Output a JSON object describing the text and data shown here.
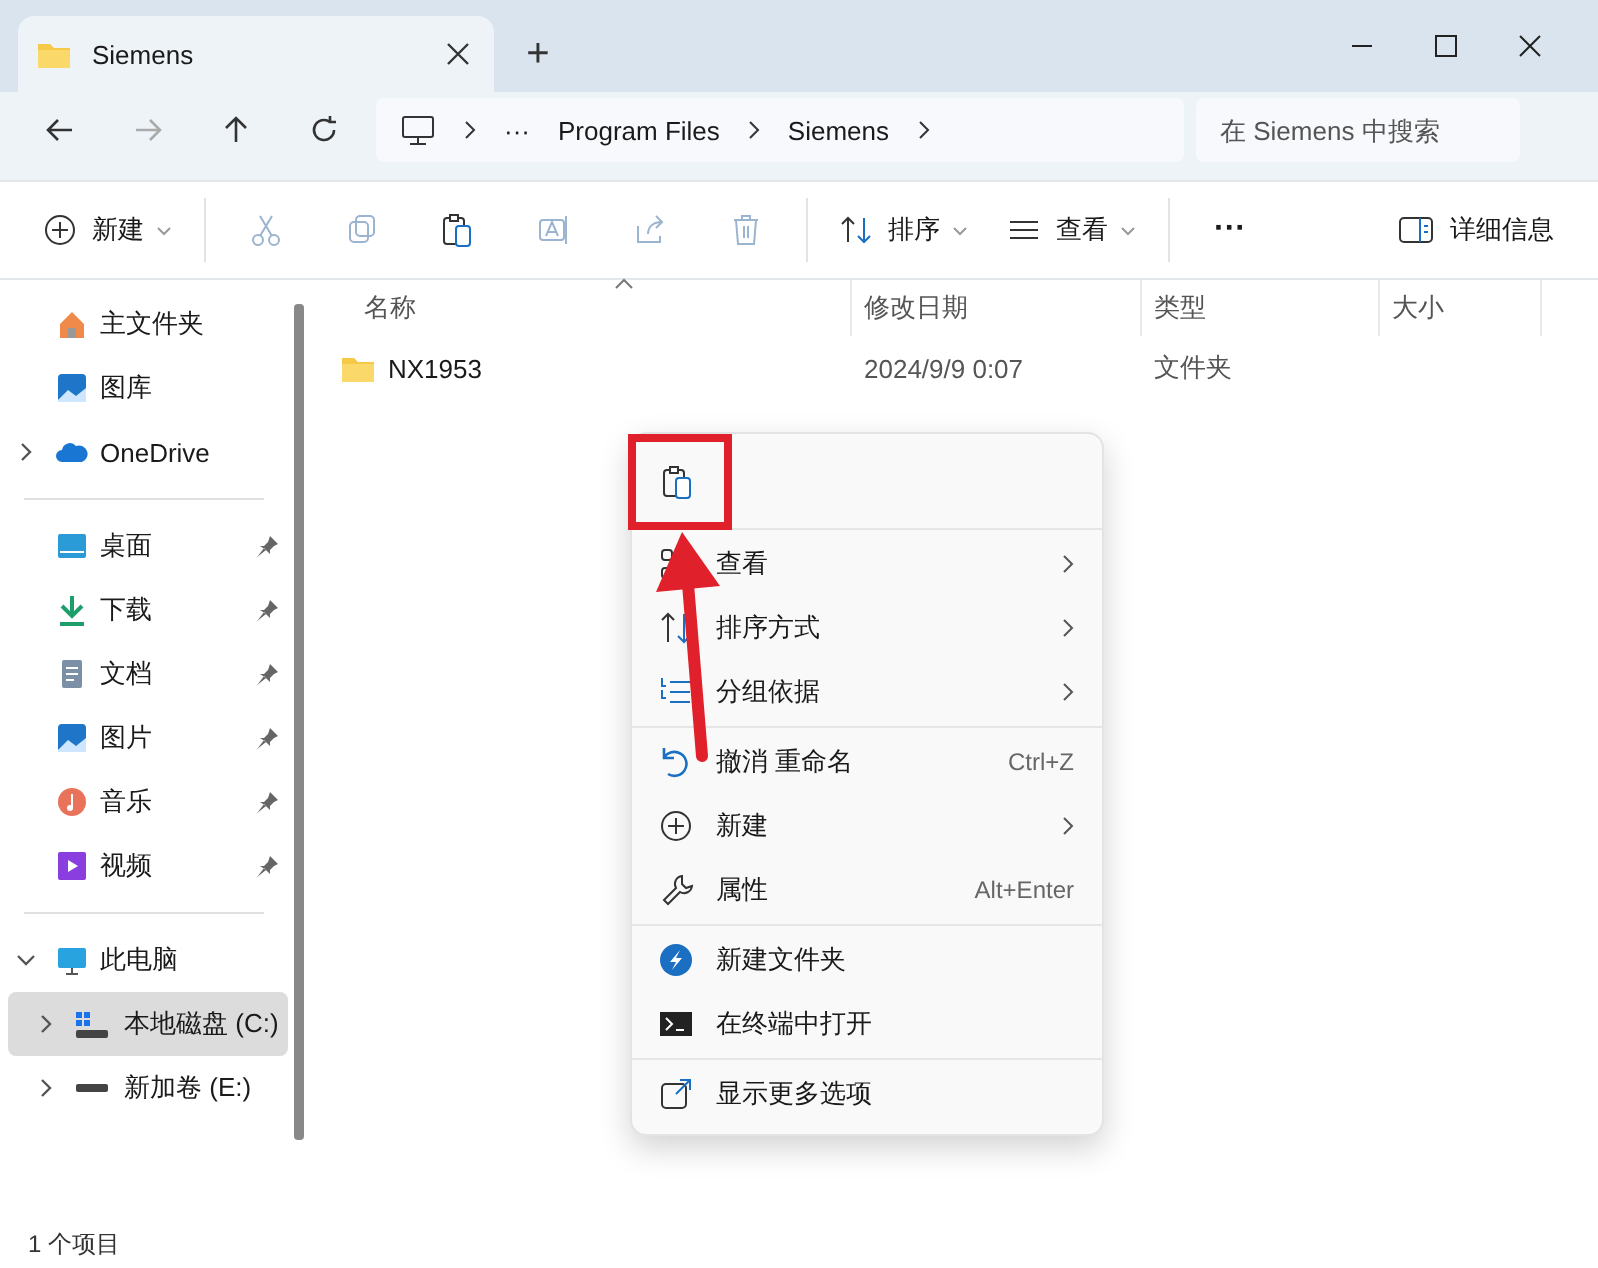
{
  "window": {
    "tab_title": "Siemens",
    "new_tab": "+"
  },
  "address": {
    "ellipsis": "···",
    "crumbs": [
      "Program Files",
      "Siemens"
    ],
    "search_placeholder": "在 Siemens 中搜索"
  },
  "toolbar": {
    "new": "新建",
    "sort": "排序",
    "view": "查看",
    "more": "···",
    "details": "详细信息"
  },
  "sidebar": {
    "groups": [
      [
        {
          "label": "主文件夹"
        },
        {
          "label": "图库"
        },
        {
          "label": "OneDrive",
          "expanded": false
        }
      ],
      [
        {
          "label": "桌面",
          "pinned": true
        },
        {
          "label": "下载",
          "pinned": true
        },
        {
          "label": "文档",
          "pinned": true
        },
        {
          "label": "图片",
          "pinned": true
        },
        {
          "label": "音乐",
          "pinned": true
        },
        {
          "label": "视频",
          "pinned": true
        }
      ],
      [
        {
          "label": "此电脑",
          "expanded": true,
          "children": [
            {
              "label": "本地磁盘 (C:)",
              "expanded": false,
              "selected": true
            },
            {
              "label": "新加卷 (E:)",
              "expanded": false,
              "selected": false
            }
          ]
        }
      ]
    ]
  },
  "table": {
    "columns": [
      "名称",
      "修改日期",
      "类型",
      "大小"
    ],
    "rows": [
      {
        "name": "NX1953",
        "modified": "2024/9/9 0:07",
        "type": "文件夹"
      }
    ]
  },
  "context_menu": {
    "items": [
      {
        "kind": "item",
        "label": "查看",
        "submenu": true
      },
      {
        "kind": "item",
        "label": "排序方式",
        "submenu": true
      },
      {
        "kind": "item",
        "label": "分组依据",
        "submenu": true
      },
      {
        "kind": "divider"
      },
      {
        "kind": "item",
        "label": "撤消 重命名",
        "shortcut": "Ctrl+Z"
      },
      {
        "kind": "item",
        "label": "新建",
        "submenu": true
      },
      {
        "kind": "item",
        "label": "属性",
        "shortcut": "Alt+Enter"
      },
      {
        "kind": "divider"
      },
      {
        "kind": "item",
        "label": "新建文件夹"
      },
      {
        "kind": "item",
        "label": "在终端中打开"
      },
      {
        "kind": "divider"
      },
      {
        "kind": "item",
        "label": "显示更多选项"
      }
    ]
  },
  "status_bar": "1 个项目"
}
